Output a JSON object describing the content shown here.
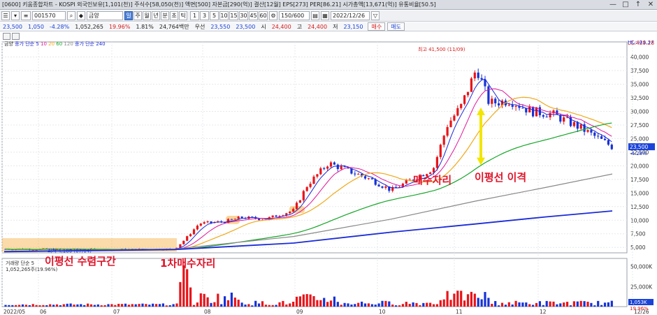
{
  "window": {
    "title": "[0600] 키움종합차트 - KOSPI 외국인보유[1,101(천)] 주식수[58,050(천)] 액면[500] 자본금[290(억)] 결산[12월] EPS[273] PER[86.21] 시가총액[13,671(억)] 유통비율[50.5]",
    "min_icon": "minimize-icon",
    "restore_icon": "restore-icon",
    "pin_icon": "pin-icon",
    "close_icon": "close-icon"
  },
  "toolbar": {
    "code": "001570",
    "name": "금양",
    "period_buttons": [
      "일",
      "주",
      "월",
      "년",
      "분",
      "초",
      "틱"
    ],
    "selected_period": "일",
    "numbers": [
      "1",
      "3",
      "5",
      "10",
      "15",
      "30",
      "45",
      "60"
    ],
    "count": "150/600",
    "date": "2022/12/26"
  },
  "quote": {
    "price": "23,500",
    "change": "1,050",
    "pct": "-4.28%",
    "volume": "1,052,265",
    "ratio": "19.96%",
    "turnover": "1.81%",
    "amount": "24,764백만",
    "prev": "우선",
    "p1": "23,550",
    "p2": "23,500",
    "open_label": "시",
    "open": "24,400",
    "high_label": "고",
    "high": "24,400",
    "low_label": "저",
    "low": "23,150",
    "buy": "매수",
    "sell": "매도"
  },
  "chart_data": {
    "type": "candlestick",
    "title": "금양",
    "legend": [
      "종가 단순 5",
      "10",
      "20",
      "60",
      "120",
      "종가 단순 240"
    ],
    "ma_colors": [
      "#1d27d4",
      "#e0169a",
      "#f0a818",
      "#16a628",
      "#888888",
      "#1a2bd8"
    ],
    "y_ticks": [
      "40,000",
      "37,500",
      "35,000",
      "32,500",
      "30,000",
      "27,500",
      "25,000",
      "22,500",
      "20,000",
      "17,500",
      "15,000",
      "12,500",
      "10,000",
      "7,500",
      "5,000"
    ],
    "ylim": [
      4000,
      42000
    ],
    "x_ticks": [
      "2022/05",
      "06",
      "07",
      "08",
      "09",
      "10",
      "11",
      "12",
      "12/26"
    ],
    "high_marker": "최고 41,500 (11/09)",
    "low_marker": "최저 4,180 (07/04)",
    "last_price_label": "23,500",
    "last_pct_label": "-4.28%",
    "lc_label": "LC:429.28",
    "hc_label": "HC:-43.37",
    "volume_legend": "거래량 단순 5",
    "volume_value": "1,052,265주(19.96%)",
    "volume_ticks": [
      "50,000K",
      "25,000K"
    ],
    "volume_last": "1,053K",
    "volume_pct": "19.96%"
  },
  "annotations": {
    "convergence": "이평선 수렴구간",
    "first_buy": "1차매수자리",
    "buy_spot": "매수자리",
    "divergence": "이평선 이격"
  },
  "colors": {
    "up": "#e8141a",
    "down": "#1632d6",
    "highlight": "#f5b041",
    "arrow": "#f2e600",
    "annotation": "#e0162b"
  }
}
